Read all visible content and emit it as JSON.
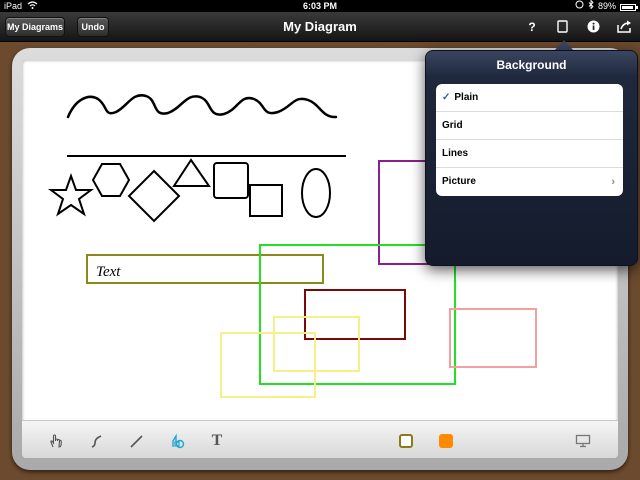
{
  "status_bar": {
    "device": "iPad",
    "time": "6:03 PM",
    "battery": "89%"
  },
  "nav_bar": {
    "left_buttons": [
      "My Diagrams",
      "Undo"
    ],
    "title": "My Diagram",
    "help_label": "?",
    "info_label": "i"
  },
  "canvas": {
    "text_box_label": "Text",
    "shape_colors": {
      "purple": "#8b1f8b",
      "green": "#22e022",
      "olive": "#8a8a1a",
      "dark_red": "#7a0a0a",
      "yellow": "#f5f08a",
      "salmon": "#f0a0a0"
    }
  },
  "popover": {
    "title": "Background",
    "options": [
      {
        "label": "Plain",
        "selected": true
      },
      {
        "label": "Grid",
        "selected": false
      },
      {
        "label": "Lines",
        "selected": false
      },
      {
        "label": "Picture",
        "selected": false,
        "has_submenu": true
      }
    ],
    "check_glyph": "✓",
    "chevron_glyph": "›"
  },
  "toolbar": {
    "tools": [
      "hand-tool-icon",
      "freehand-tool-icon",
      "line-tool-icon",
      "shape-tool-icon",
      "text-tool-icon"
    ],
    "text_tool_glyph": "T",
    "stroke_color": "#8a7a1a",
    "fill_color": "#ff8a00"
  }
}
